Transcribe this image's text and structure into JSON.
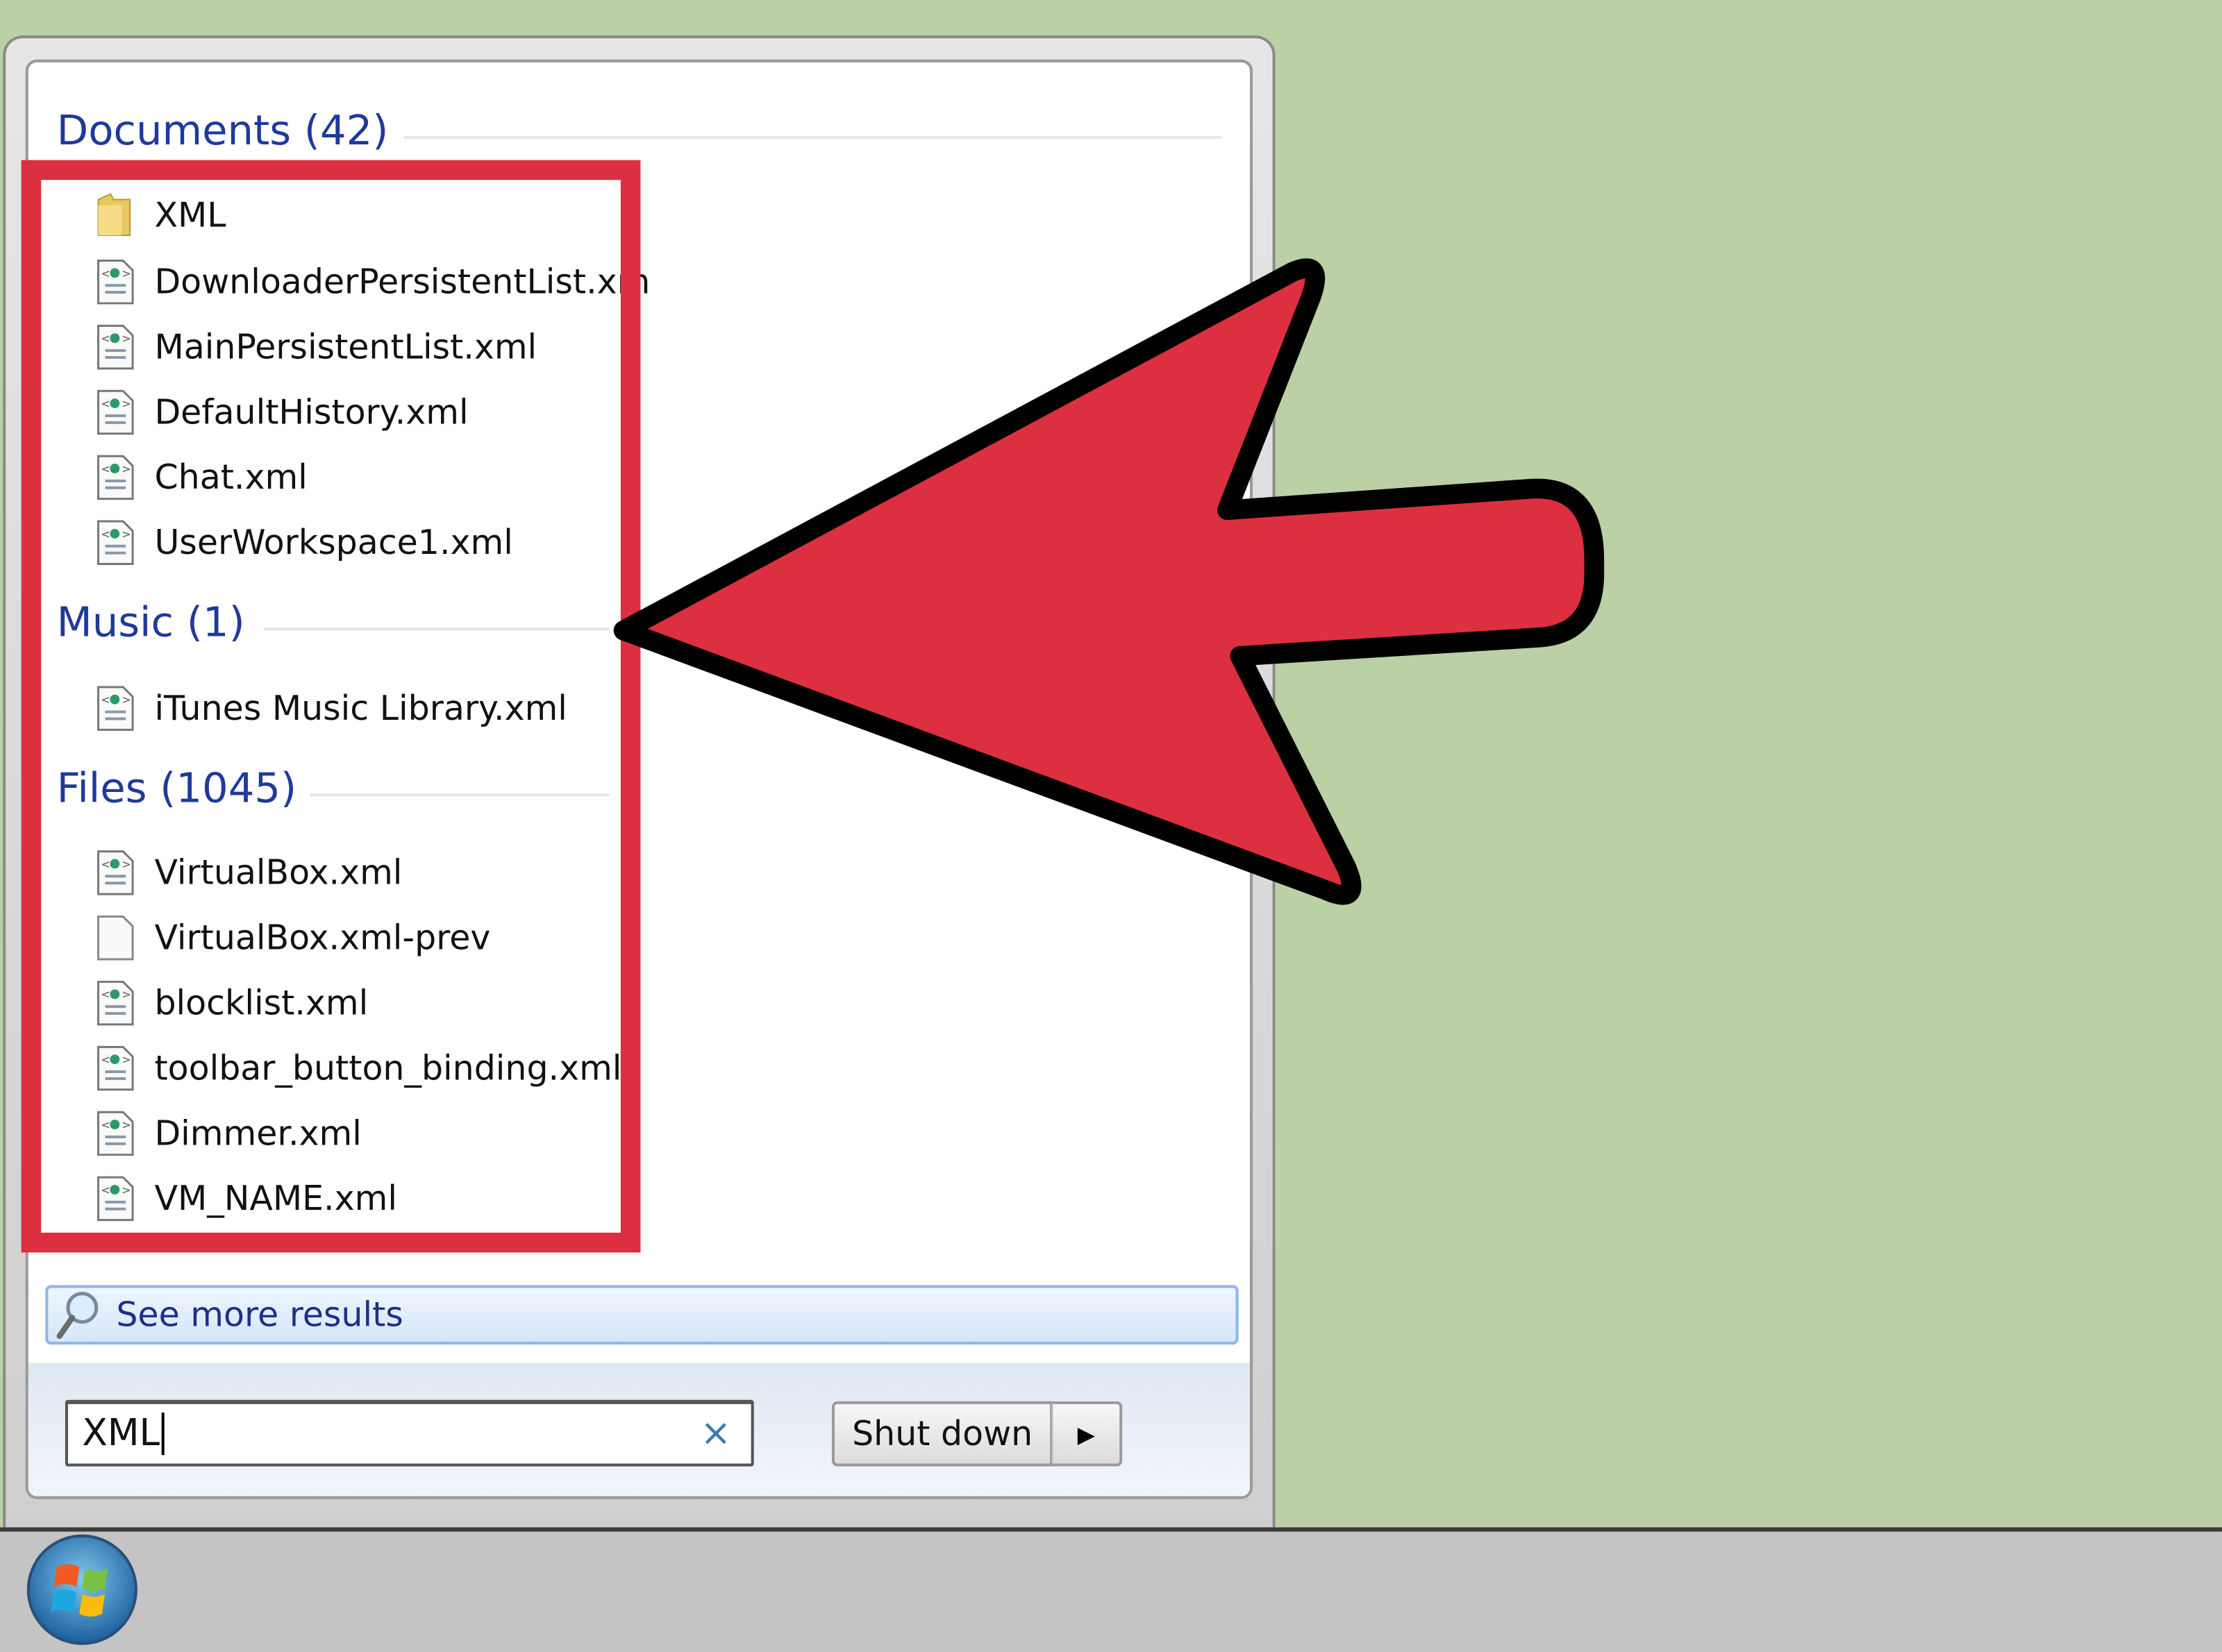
{
  "colors": {
    "background": "#bbd1a5",
    "category_header": "#1e3a9a",
    "highlight_box": "#dc3040",
    "arrow_fill": "#dc3040",
    "arrow_stroke": "#000000"
  },
  "start_menu": {
    "sections": [
      {
        "title": "Documents (42)",
        "items": [
          {
            "label": "XML",
            "icon": "folder-icon"
          },
          {
            "label": "DownloaderPersistentList.xm",
            "icon": "xml-file-icon"
          },
          {
            "label": "MainPersistentList.xml",
            "icon": "xml-file-icon"
          },
          {
            "label": "DefaultHistory.xml",
            "icon": "xml-file-icon"
          },
          {
            "label": "Chat.xml",
            "icon": "xml-file-icon"
          },
          {
            "label": "UserWorkspace1.xml",
            "icon": "xml-file-icon"
          }
        ]
      },
      {
        "title": "Music (1)",
        "items": [
          {
            "label": "iTunes Music Library.xml",
            "icon": "xml-file-icon"
          }
        ]
      },
      {
        "title": "Files (1045)",
        "items": [
          {
            "label": "VirtualBox.xml",
            "icon": "xml-file-icon"
          },
          {
            "label": "VirtualBox.xml-prev",
            "icon": "blank-file-icon"
          },
          {
            "label": "blocklist.xml",
            "icon": "xml-file-icon"
          },
          {
            "label": "toolbar_button_binding.xml",
            "icon": "xml-file-icon"
          },
          {
            "label": "Dimmer.xml",
            "icon": "xml-file-icon"
          },
          {
            "label": "VM_NAME.xml",
            "icon": "xml-file-icon"
          }
        ]
      }
    ],
    "see_more": "See more results",
    "search_value": "XML",
    "clear_glyph": "×",
    "shutdown_label": "Shut down",
    "shutdown_arrow": "▶"
  }
}
